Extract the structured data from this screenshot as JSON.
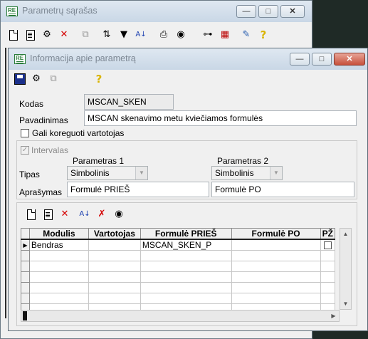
{
  "back_window": {
    "title": "Parametrų sąrašas",
    "toolbar_icons": [
      "new-doc-icon",
      "doc-lines-icon",
      "tree-edit-icon",
      "delete-icon",
      "copy-icon",
      "sort-tree-icon",
      "filter-icon",
      "sort-az-icon",
      "print-icon",
      "find-icon",
      "hierarchy-icon",
      "grid-icon",
      "tools-icon",
      "help-icon"
    ]
  },
  "window": {
    "title": "Informacija apie parametrą",
    "controls": {
      "minimize": "—",
      "maximize": "□",
      "close": "✕"
    }
  },
  "form": {
    "kodas_label": "Kodas",
    "kodas_value": "MSCAN_SKEN",
    "pavadinimas_label": "Pavadinimas",
    "pavadinimas_value": "MSCAN skenavimo metu kviečiamos formulės",
    "gali_koreguoti_label": "Gali koreguoti vartotojas",
    "gali_koreguoti_checked": false,
    "intervalas_label": "Intervalas",
    "intervalas_checked": true,
    "param1_header": "Parametras 1",
    "param2_header": "Parametras 2",
    "tipas_label": "Tipas",
    "tipas1_value": "Simbolinis",
    "tipas2_value": "Simbolinis",
    "aprasymas_label": "Aprašymas",
    "aprasymas1_value": "Formulė PRIEŠ",
    "aprasymas2_value": "Formulė PO"
  },
  "grid": {
    "columns": [
      "Modulis",
      "Vartotojas",
      "Formulė PRIEŠ",
      "Formulė PO",
      "PŽ"
    ],
    "rows": [
      {
        "modulis": "Bendras",
        "vartotojas": "",
        "pries": "MSCAN_SKEN_P",
        "po": "",
        "pz": false
      }
    ]
  }
}
